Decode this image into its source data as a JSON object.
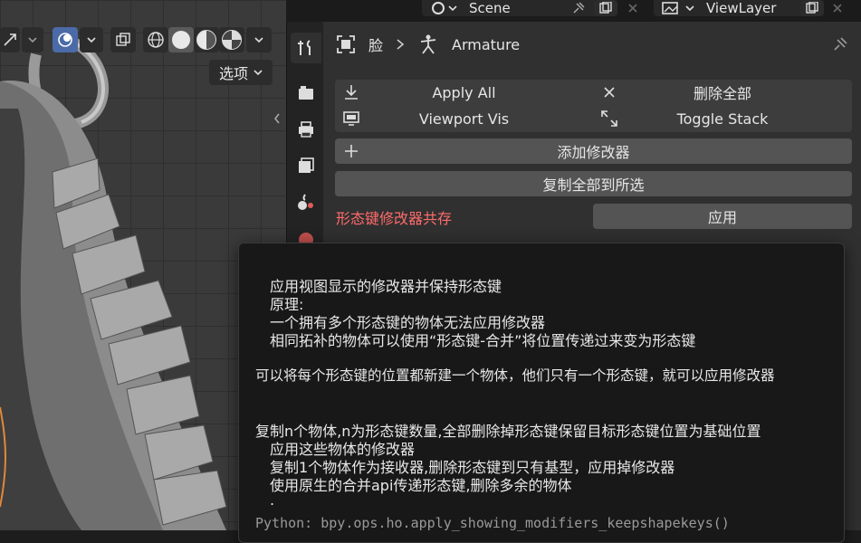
{
  "top_strip": {
    "scene_label": "Scene",
    "view_layer_label": "ViewLayer"
  },
  "viewport": {
    "options_label": "选项"
  },
  "breadcrumb": {
    "object": "脸",
    "data": "Armature"
  },
  "modifier_tools": {
    "apply_all": "Apply All",
    "delete_all": "删除全部",
    "viewport_vis": "Viewport Vis",
    "toggle_stack": "Toggle Stack",
    "add_modifier": "添加修改器",
    "copy_all_to_selected": "复制全部到所选",
    "shapekey_coexist_label": "形态键修改器共存",
    "apply": "应用"
  },
  "tooltip": {
    "lines": [
      "应用视图显示的修改器并保持形态键",
      "原理:",
      "一个拥有多个形态键的物体无法应用修改器",
      "相同拓补的物体可以使用“形态键-合并”将位置传递过来变为形态键",
      "可以将每个形态键的位置都新建一个物体，他们只有一个形态键，就可以应用修改器",
      "复制n个物体,n为形态键数量,全部删除掉形态键保留目标形态键位置为基础位置",
      "应用这些物体的修改器",
      "复制1个物体作为接收器,删除形态键到只有基型，应用掉修改器",
      "使用原生的合并api传递形态键,删除多余的物体",
      "."
    ],
    "python": "Python: bpy.ops.ho.apply_showing_modifiers_keepshapekeys()"
  },
  "colors": {
    "accent_blue": "#4b6aa8",
    "warning_red": "#ff6b6b",
    "button_gray": "#545454",
    "panel_bg": "#303030"
  }
}
